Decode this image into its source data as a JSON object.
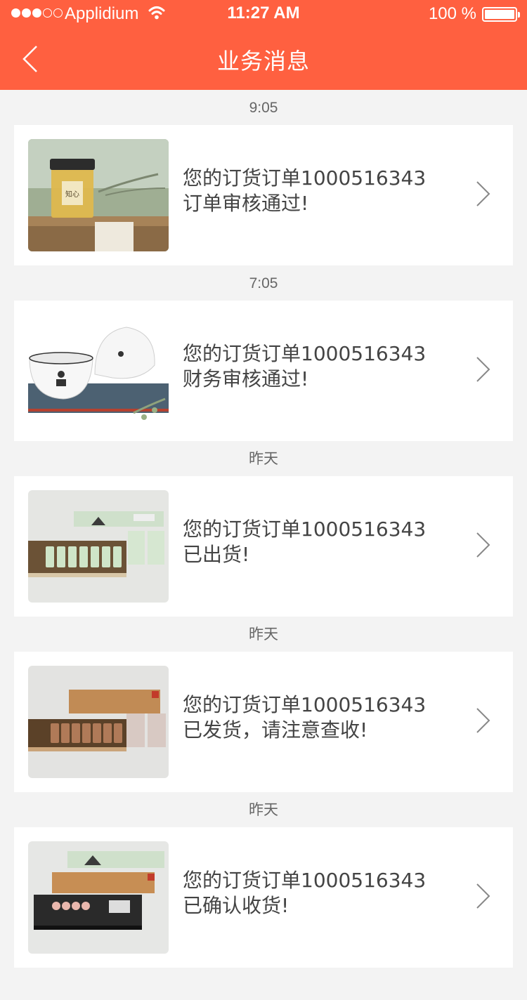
{
  "status_bar": {
    "carrier": "Applidium",
    "time": "11:27 AM",
    "battery": "100 %"
  },
  "nav": {
    "title": "业务消息",
    "back_icon": "chevron-left-icon"
  },
  "messages": [
    {
      "time": "9:05",
      "line1": "您的订货订单1000516343",
      "line2": "订单审核通过!",
      "image": "honey-jar-photo"
    },
    {
      "time": "7:05",
      "line1": "您的订货订单1000516343",
      "line2": "财务审核通过!",
      "image": "tea-cups-photo"
    },
    {
      "time": "昨天",
      "line1": "您的订货订单1000516343",
      "line2": "已出货!",
      "image": "green-tea-box-photo"
    },
    {
      "time": "昨天",
      "line1": "您的订货订单1000516343",
      "line2": "已发货，请注意查收!",
      "image": "brown-tea-box-photo"
    },
    {
      "time": "昨天",
      "line1": "您的订货订单1000516343",
      "line2": "已确认收货!",
      "image": "tea-gift-boxes-photo"
    }
  ],
  "colors": {
    "header": "#ff6040",
    "background": "#f3f3f3",
    "card": "#ffffff"
  }
}
